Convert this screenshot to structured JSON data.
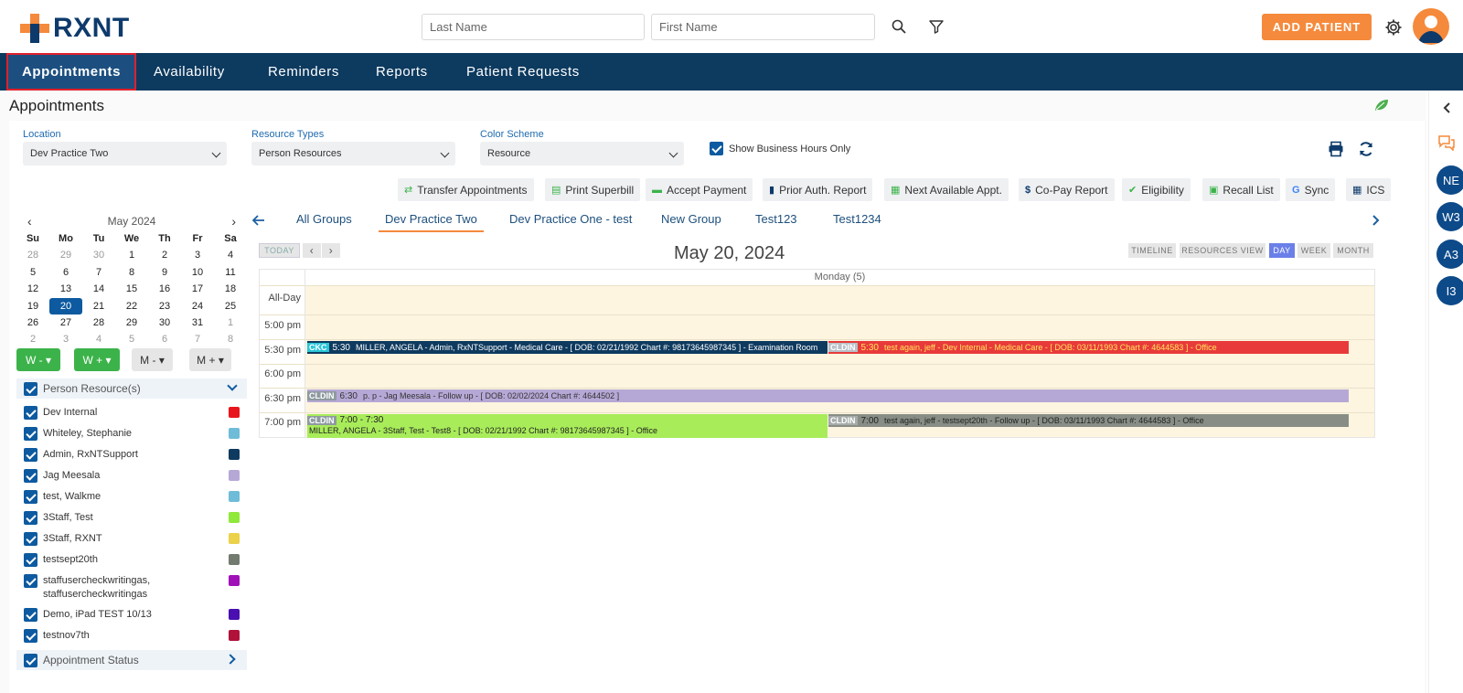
{
  "brand": {
    "name": "RXNT"
  },
  "search": {
    "last_placeholder": "Last Name",
    "first_placeholder": "First Name"
  },
  "header": {
    "add_patient": "ADD PATIENT"
  },
  "nav": {
    "items": [
      "Appointments",
      "Availability",
      "Reminders",
      "Reports",
      "Patient Requests"
    ]
  },
  "page": {
    "title": "Appointments"
  },
  "filters": {
    "location_label": "Location",
    "location_value": "Dev Practice Two",
    "resource_label": "Resource Types",
    "resource_value": "Person Resources",
    "color_label": "Color Scheme",
    "color_value": "Resource",
    "business_hours": "Show Business Hours Only"
  },
  "toolbar": [
    "Transfer Appointments",
    "Print Superbill",
    "Accept Payment",
    "Prior Auth. Report",
    "Next Available Appt.",
    "Co-Pay Report",
    "Eligibility",
    "Recall List",
    "Sync",
    "ICS"
  ],
  "mini_cal": {
    "month": "May 2024",
    "dow": [
      "Su",
      "Mo",
      "Tu",
      "We",
      "Th",
      "Fr",
      "Sa"
    ],
    "weeks": [
      [
        "28",
        "29",
        "30",
        "1",
        "2",
        "3",
        "4"
      ],
      [
        "5",
        "6",
        "7",
        "8",
        "9",
        "10",
        "11"
      ],
      [
        "12",
        "13",
        "14",
        "15",
        "16",
        "17",
        "18"
      ],
      [
        "19",
        "20",
        "21",
        "22",
        "23",
        "24",
        "25"
      ],
      [
        "26",
        "27",
        "28",
        "29",
        "30",
        "31",
        "1"
      ],
      [
        "2",
        "3",
        "4",
        "5",
        "6",
        "7",
        "8"
      ]
    ],
    "selected": "20"
  },
  "wm_buttons": [
    "W -",
    "W +",
    "M -",
    "M +"
  ],
  "resources": {
    "header": "Person Resource(s)",
    "items": [
      {
        "name": "Dev Internal",
        "color": "#e8161c"
      },
      {
        "name": "Whiteley, Stephanie",
        "color": "#6fbcd8"
      },
      {
        "name": "Admin, RxNTSupport",
        "color": "#0e3a5f"
      },
      {
        "name": "Jag Meesala",
        "color": "#b6a8d6"
      },
      {
        "name": "test, Walkme",
        "color": "#6fbcd8"
      },
      {
        "name": "3Staff, Test",
        "color": "#8fe83a"
      },
      {
        "name": "3Staff, RXNT",
        "color": "#ecd14a"
      },
      {
        "name": "testsept20th",
        "color": "#737b70"
      },
      {
        "name": "staffusercheckwritingas, staffusercheckwritingas",
        "color": "#a012b8"
      },
      {
        "name": "Demo, iPad TEST 10/13",
        "color": "#4a0fb0"
      },
      {
        "name": "testnov7th",
        "color": "#b0123a"
      }
    ],
    "status_header": "Appointment Status"
  },
  "groups": [
    "All Groups",
    "Dev Practice Two",
    "Dev Practice One - test",
    "New Group",
    "Test123",
    "Test1234"
  ],
  "scheduler": {
    "today": "TODAY",
    "date": "May 20, 2024",
    "views": [
      "TIMELINE",
      "RESOURCES VIEW",
      "DAY",
      "WEEK",
      "MONTH"
    ],
    "day_header": "Monday (5)",
    "times": [
      "All-Day",
      "5:00 pm",
      "5:30 pm",
      "6:00 pm",
      "6:30 pm",
      "7:00 pm"
    ],
    "appts": [
      {
        "tag": "CKC",
        "time": "5:30",
        "text": "MILLER, ANGELA - Admin, RxNTSupport - Medical Care - [ DOB: 02/21/1992 Chart #: 98173645987345 ] - Examination Room",
        "color": "#0e3a5f"
      },
      {
        "tag": "CLDIN",
        "time": "5:30",
        "text": "test again, jeff - Dev Internal - Medical Care - [ DOB: 03/11/1993 Chart #: 4644583 ] - Office",
        "color": "#e83a3a"
      },
      {
        "tag": "CLDIN",
        "time": "6:30",
        "text": "p. p - Jag Meesala - Follow up - [ DOB: 02/02/2024 Chart #: 4644502 ]",
        "color": "#b6a8d6"
      },
      {
        "tag": "CLDIN",
        "time": "7:00 - 7:30",
        "text": "MILLER, ANGELA - 3Staff, Test - Test8 - [ DOB: 02/21/1992 Chart #: 98173645987345 ] - Office",
        "color": "#a8ec5a"
      },
      {
        "tag": "CLDIN",
        "time": "7:00",
        "text": "test again, jeff - testsept20th - Follow up - [ DOB: 03/11/1993 Chart #: 4644583 ] - Office",
        "color": "#888e86"
      }
    ]
  },
  "rail": [
    "NE",
    "W3",
    "A3",
    "I3"
  ]
}
